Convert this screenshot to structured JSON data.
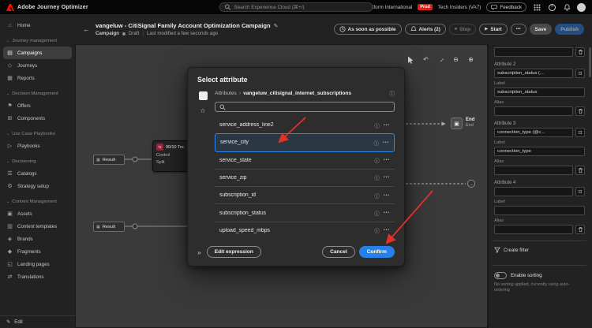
{
  "topbar": {
    "app_name": "Adobe Journey Optimizer",
    "search_placeholder": "Search Experience Cloud (⌘+/)",
    "org_name": "Experience Platform International",
    "env_badge": "Prod",
    "tenant": "Tech Insiders (VA7)",
    "feedback_label": "Feedback"
  },
  "titlebar": {
    "title": "vangeluw - CitiSignal Family Account Optimization Campaign",
    "type_label": "Campaign",
    "status": "Draft",
    "last_modified": "Last modified a few seconds ago",
    "buttons": {
      "schedule": "As soon as possible",
      "alerts": "Alerts (2)",
      "stop": "Stop",
      "start": "Start",
      "more": "•••",
      "save": "Save",
      "publish": "Publish"
    }
  },
  "sidebar": {
    "items": [
      {
        "label": "Home"
      },
      {
        "label": "Journey management"
      },
      {
        "label": "Campaigns"
      },
      {
        "label": "Journeys"
      },
      {
        "label": "Reports"
      },
      {
        "label": "Decision Management"
      },
      {
        "label": "Offers"
      },
      {
        "label": "Components"
      },
      {
        "label": "Use Case Playbooks"
      },
      {
        "label": "Playbooks"
      },
      {
        "label": "Decisioning"
      },
      {
        "label": "Catalogs"
      },
      {
        "label": "Strategy setup"
      },
      {
        "label": "Content Management"
      },
      {
        "label": "Assets"
      },
      {
        "label": "Content templates"
      },
      {
        "label": "Brands"
      },
      {
        "label": "Fragments"
      },
      {
        "label": "Landing pages"
      },
      {
        "label": "Translations"
      }
    ],
    "footer_label": "Edit"
  },
  "canvas": {
    "result_node_1": "Result",
    "result_node_2": "Result",
    "split_node": {
      "title": "90/10 Tre...",
      "line1": "Control",
      "line2": "Split"
    },
    "end_node": {
      "label": "End",
      "sublabel": "End"
    }
  },
  "right_panel": {
    "partial_alias_value": "",
    "groups": [
      {
        "heading": "Attribute 2",
        "value": "subscription_status (...",
        "label_caption": "Label",
        "label_value": "subscription_status",
        "alias_caption": "Alias",
        "alias_value": ""
      },
      {
        "heading": "Attribute 3",
        "value": "connection_type (@c...",
        "label_caption": "Label",
        "label_value": "connection_type",
        "alias_caption": "Alias",
        "alias_value": ""
      },
      {
        "heading": "Attribute 4",
        "value": "",
        "label_caption": "Label",
        "label_value": "",
        "alias_caption": "Alias",
        "alias_value": ""
      }
    ],
    "create_filter_label": "Create filter",
    "enable_sorting_label": "Enable sorting",
    "sorting_note": "No sorting applied, currently using auto-ordering"
  },
  "modal": {
    "title": "Select attribute",
    "breadcrumb_root": "Attributes",
    "breadcrumb_current": "vangeluw_citisignal_internet_subscriptions",
    "search_placeholder": "",
    "attributes": [
      {
        "name": "service_address_line2"
      },
      {
        "name": "service_city"
      },
      {
        "name": "service_state"
      },
      {
        "name": "service_zip"
      },
      {
        "name": "subscription_id"
      },
      {
        "name": "subscription_status"
      },
      {
        "name": "upload_speed_mbps"
      }
    ],
    "edit_expression": "Edit expression",
    "cancel": "Cancel",
    "confirm": "Confirm"
  },
  "icons": {
    "back": "←",
    "edit_pencil": "✎",
    "play": "▶",
    "stop": "■",
    "more": "•••",
    "undo": "↶",
    "fit": "↔",
    "zoom_out": "⊖",
    "zoom_in": "⊕",
    "chevron_section": "⌄",
    "home": "⌂",
    "campaigns": "▤",
    "journeys": "◇",
    "reports": "▦",
    "offers": "⚑",
    "components": "⊞",
    "playbooks": "▷",
    "catalogs": "☰",
    "strategy": "⚙",
    "assets": "▣",
    "templates": "▥",
    "brands": "◈",
    "fragments": "◆",
    "landing": "◱",
    "translations": "⇄",
    "info": "ⓘ",
    "star": "☆",
    "collapse": "»",
    "picker": "⊡",
    "breadcrumb_sep": "›",
    "result_node": "▦",
    "split_node": "⇆",
    "end_node": "▣",
    "help": "?"
  },
  "colors": {
    "accent_blue": "#2680eb",
    "annotation_red": "#e33127",
    "badge_red": "#dd2118",
    "adobe_red": "#fa0f00"
  }
}
